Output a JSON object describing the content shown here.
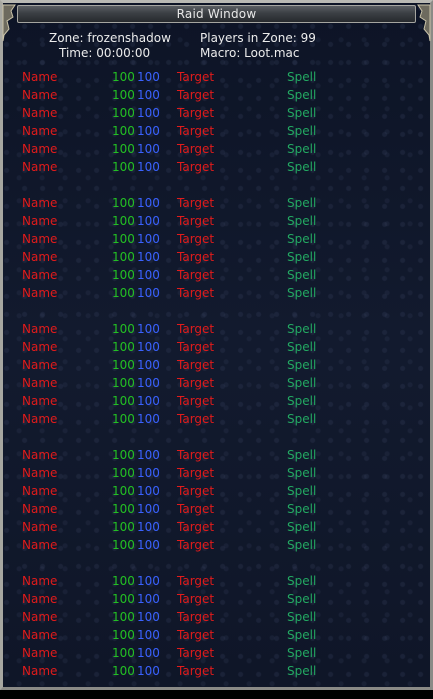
{
  "window": {
    "title": "Raid Window"
  },
  "info": {
    "zone_label": "Zone: frozenshadow",
    "time_label": "Time: 00:00:00",
    "players_label": "Players in Zone: 99",
    "macro_label": "Macro: Loot.mac"
  },
  "colors": {
    "name": "#e11b1b",
    "hp": "#23c023",
    "mana": "#3a62ff",
    "target": "#e11b1b",
    "spell": "#23a862"
  },
  "groups": [
    {
      "members": [
        {
          "name": "Name",
          "hp": "100",
          "mana": "100",
          "target": "Target",
          "spell": "Spell"
        },
        {
          "name": "Name",
          "hp": "100",
          "mana": "100",
          "target": "Target",
          "spell": "Spell"
        },
        {
          "name": "Name",
          "hp": "100",
          "mana": "100",
          "target": "Target",
          "spell": "Spell"
        },
        {
          "name": "Name",
          "hp": "100",
          "mana": "100",
          "target": "Target",
          "spell": "Spell"
        },
        {
          "name": "Name",
          "hp": "100",
          "mana": "100",
          "target": "Target",
          "spell": "Spell"
        },
        {
          "name": "Name",
          "hp": "100",
          "mana": "100",
          "target": "Target",
          "spell": "Spell"
        }
      ]
    },
    {
      "members": [
        {
          "name": "Name",
          "hp": "100",
          "mana": "100",
          "target": "Target",
          "spell": "Spell"
        },
        {
          "name": "Name",
          "hp": "100",
          "mana": "100",
          "target": "Target",
          "spell": "Spell"
        },
        {
          "name": "Name",
          "hp": "100",
          "mana": "100",
          "target": "Target",
          "spell": "Spell"
        },
        {
          "name": "Name",
          "hp": "100",
          "mana": "100",
          "target": "Target",
          "spell": "Spell"
        },
        {
          "name": "Name",
          "hp": "100",
          "mana": "100",
          "target": "Target",
          "spell": "Spell"
        },
        {
          "name": "Name",
          "hp": "100",
          "mana": "100",
          "target": "Target",
          "spell": "Spell"
        }
      ]
    },
    {
      "members": [
        {
          "name": "Name",
          "hp": "100",
          "mana": "100",
          "target": "Target",
          "spell": "Spell"
        },
        {
          "name": "Name",
          "hp": "100",
          "mana": "100",
          "target": "Target",
          "spell": "Spell"
        },
        {
          "name": "Name",
          "hp": "100",
          "mana": "100",
          "target": "Target",
          "spell": "Spell"
        },
        {
          "name": "Name",
          "hp": "100",
          "mana": "100",
          "target": "Target",
          "spell": "Spell"
        },
        {
          "name": "Name",
          "hp": "100",
          "mana": "100",
          "target": "Target",
          "spell": "Spell"
        },
        {
          "name": "Name",
          "hp": "100",
          "mana": "100",
          "target": "Target",
          "spell": "Spell"
        }
      ]
    },
    {
      "members": [
        {
          "name": "Name",
          "hp": "100",
          "mana": "100",
          "target": "Target",
          "spell": "Spell"
        },
        {
          "name": "Name",
          "hp": "100",
          "mana": "100",
          "target": "Target",
          "spell": "Spell"
        },
        {
          "name": "Name",
          "hp": "100",
          "mana": "100",
          "target": "Target",
          "spell": "Spell"
        },
        {
          "name": "Name",
          "hp": "100",
          "mana": "100",
          "target": "Target",
          "spell": "Spell"
        },
        {
          "name": "Name",
          "hp": "100",
          "mana": "100",
          "target": "Target",
          "spell": "Spell"
        },
        {
          "name": "Name",
          "hp": "100",
          "mana": "100",
          "target": "Target",
          "spell": "Spell"
        }
      ]
    },
    {
      "members": [
        {
          "name": "Name",
          "hp": "100",
          "mana": "100",
          "target": "Target",
          "spell": "Spell"
        },
        {
          "name": "Name",
          "hp": "100",
          "mana": "100",
          "target": "Target",
          "spell": "Spell"
        },
        {
          "name": "Name",
          "hp": "100",
          "mana": "100",
          "target": "Target",
          "spell": "Spell"
        },
        {
          "name": "Name",
          "hp": "100",
          "mana": "100",
          "target": "Target",
          "spell": "Spell"
        },
        {
          "name": "Name",
          "hp": "100",
          "mana": "100",
          "target": "Target",
          "spell": "Spell"
        },
        {
          "name": "Name",
          "hp": "100",
          "mana": "100",
          "target": "Target",
          "spell": "Spell"
        }
      ]
    }
  ]
}
